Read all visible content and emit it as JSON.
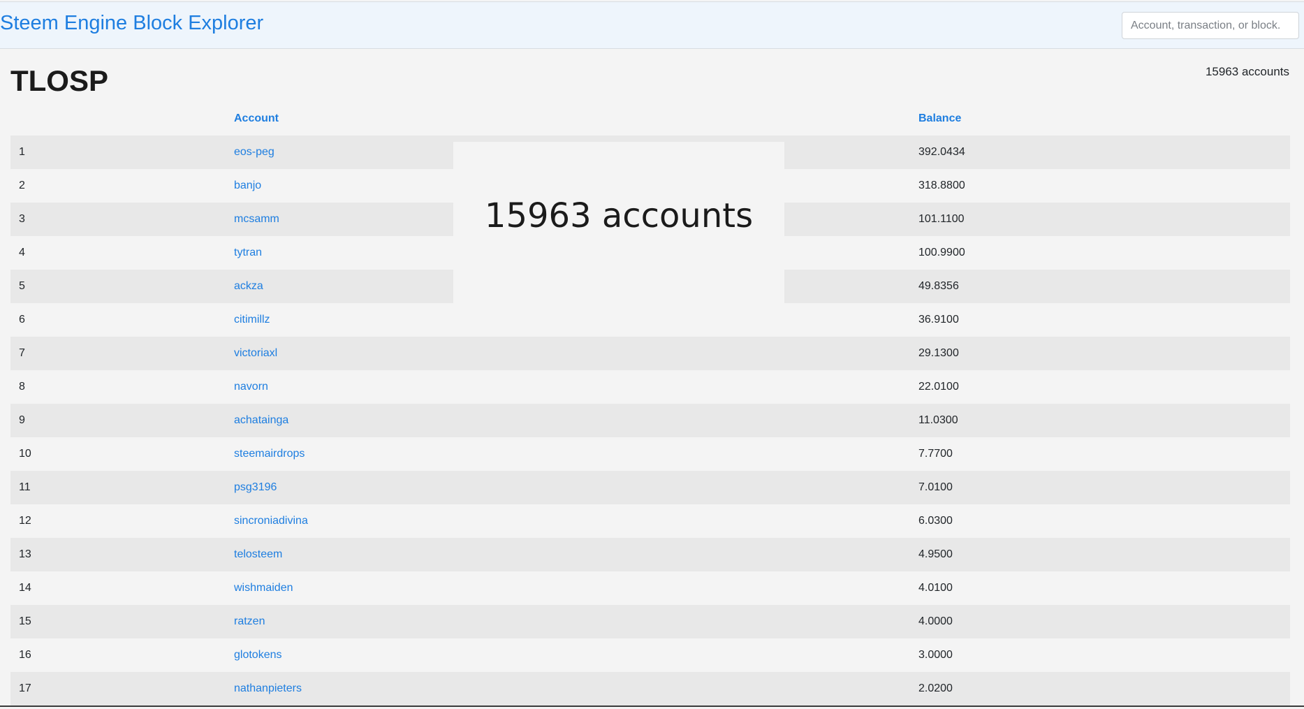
{
  "header": {
    "brand": "Steem Engine Block Explorer",
    "search_placeholder": "Account, transaction, or block."
  },
  "token": {
    "symbol": "TLOSP",
    "count_label": "15963 accounts"
  },
  "overlay": {
    "label": "15963 accounts"
  },
  "table": {
    "headers": {
      "account": "Account",
      "balance": "Balance"
    },
    "rows": [
      {
        "rank": "1",
        "account": "eos-peg",
        "balance": "392.0434"
      },
      {
        "rank": "2",
        "account": "banjo",
        "balance": "318.8800"
      },
      {
        "rank": "3",
        "account": "mcsamm",
        "balance": "101.1100"
      },
      {
        "rank": "4",
        "account": "tytran",
        "balance": "100.9900"
      },
      {
        "rank": "5",
        "account": "ackza",
        "balance": "49.8356"
      },
      {
        "rank": "6",
        "account": "citimillz",
        "balance": "36.9100"
      },
      {
        "rank": "7",
        "account": "victoriaxl",
        "balance": "29.1300"
      },
      {
        "rank": "8",
        "account": "navorn",
        "balance": "22.0100"
      },
      {
        "rank": "9",
        "account": "achatainga",
        "balance": "11.0300"
      },
      {
        "rank": "10",
        "account": "steemairdrops",
        "balance": "7.7700"
      },
      {
        "rank": "11",
        "account": "psg3196",
        "balance": "7.0100"
      },
      {
        "rank": "12",
        "account": "sincroniadivina",
        "balance": "6.0300"
      },
      {
        "rank": "13",
        "account": "telosteem",
        "balance": "4.9500"
      },
      {
        "rank": "14",
        "account": "wishmaiden",
        "balance": "4.0100"
      },
      {
        "rank": "15",
        "account": "ratzen",
        "balance": "4.0000"
      },
      {
        "rank": "16",
        "account": "glotokens",
        "balance": "3.0000"
      },
      {
        "rank": "17",
        "account": "nathanpieters",
        "balance": "2.0200"
      }
    ]
  }
}
